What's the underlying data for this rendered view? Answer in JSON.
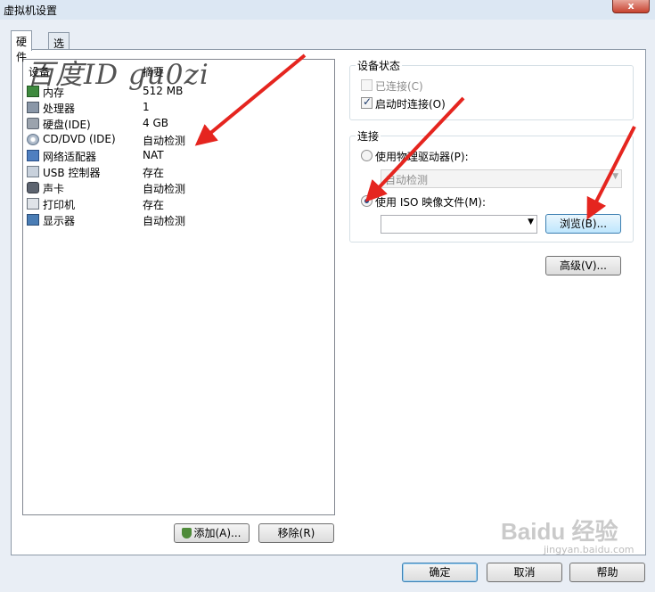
{
  "window": {
    "title": "虚拟机设置",
    "close": "x"
  },
  "tabs": [
    {
      "label": "硬件"
    },
    {
      "label": "选项"
    }
  ],
  "hardware": {
    "headers": {
      "device": "设备",
      "summary": "摘要"
    },
    "rows": [
      {
        "name": "内存",
        "value": "512 MB",
        "icon": "memory-icon"
      },
      {
        "name": "处理器",
        "value": "1",
        "icon": "cpu-icon"
      },
      {
        "name": "硬盘(IDE)",
        "value": "4 GB",
        "icon": "harddisk-icon"
      },
      {
        "name": "CD/DVD (IDE)",
        "value": "自动检测",
        "icon": "cd-dvd-icon"
      },
      {
        "name": "网络适配器",
        "value": "NAT",
        "icon": "network-adapter-icon"
      },
      {
        "name": "USB 控制器",
        "value": "存在",
        "icon": "usb-icon"
      },
      {
        "name": "声卡",
        "value": "自动检测",
        "icon": "sound-card-icon"
      },
      {
        "name": "打印机",
        "value": "存在",
        "icon": "printer-icon"
      },
      {
        "name": "显示器",
        "value": "自动检测",
        "icon": "display-icon"
      }
    ],
    "add_button": "添加(A)...",
    "remove_button": "移除(R)"
  },
  "device_status": {
    "title": "设备状态",
    "connected": "已连接(C)",
    "connect_at_power_on": "启动时连接(O)"
  },
  "connection": {
    "title": "连接",
    "use_physical_drive": "使用物理驱动器(P):",
    "physical_drive_value": "自动检测",
    "use_iso": "使用 ISO 映像文件(M):",
    "iso_path": "",
    "browse_button": "浏览(B)..."
  },
  "advanced_button": "高级(V)...",
  "footer": {
    "ok": "确定",
    "cancel": "取消",
    "help": "帮助"
  },
  "watermark": "百度ID  gu0zi",
  "baidu_watermark": "Baidu 经验",
  "baidu_sub": "jingyan.baidu.com",
  "colors": {
    "arrow": "#e5251f",
    "accent": "#3c7fb1"
  }
}
